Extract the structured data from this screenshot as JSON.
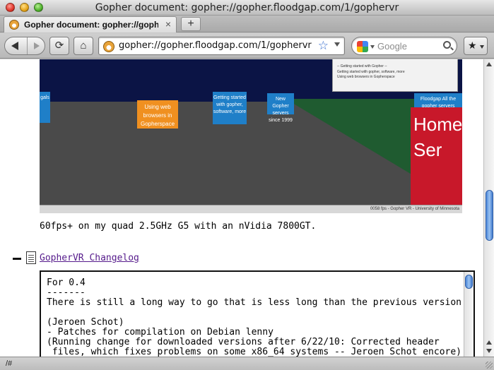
{
  "window": {
    "title": "Gopher document: gopher://gopher.floodgap.com/1/gophervr"
  },
  "tabs": [
    {
      "label": "Gopher document: gopher://goph...",
      "close": "×"
    }
  ],
  "newtab": {
    "label": "+"
  },
  "nav": {
    "url": "gopher://gopher.floodgap.com/1/gophervr",
    "search_placeholder": "Google"
  },
  "content": {
    "vr_image": {
      "signs": {
        "orange": "Using web browsers in Gopherspace",
        "blue1": "Getting started with gopher, software, more",
        "blue2": "New Gopher servers since 1999",
        "blue3": "gals",
        "blue4": "Floodgap All the gopher servers",
        "red": "Home Ser"
      },
      "panel": {
        "title": "-- Getting started with Gopher --",
        "line1": "Getting started with gopher, software, more",
        "line2": "Using web browsers in Gopherspace"
      },
      "status": "0058 fps - Gopher VR - University of Minnesota"
    },
    "caption": "60fps+ on my quad 2.5GHz G5 with an nVidia 7800GT.",
    "changelog_link": "GopherVR Changelog",
    "changelog_lines": [
      "For 0.4",
      "-------",
      "There is still a long way to go that is less long than the previous version.",
      "",
      "(Jeroen Schot)",
      "- Patches for compilation on Debian lenny",
      "(Running change for downloaded versions after 6/22/10: Corrected header",
      " files, which fixes problems on some x86_64 systems -- Jeroen Schot encore)"
    ]
  },
  "statusbar": {
    "text": "/#"
  },
  "colors": {
    "link_visited": "#551a8b",
    "accent_scroll": "#4a85d8"
  }
}
